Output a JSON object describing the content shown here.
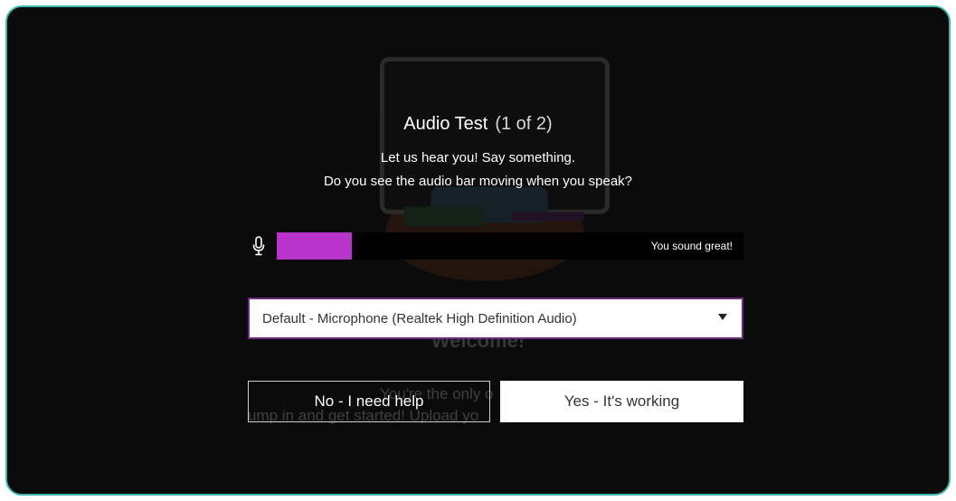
{
  "dialog": {
    "title": "Audio Test",
    "step": "(1 of 2)",
    "instruction_1": "Let us hear you! Say something.",
    "instruction_2": "Do you see the audio bar moving when you speak?"
  },
  "meter": {
    "level": 0.16,
    "status": "You sound great!",
    "fill_color": "#b833c9",
    "icon": "microphone-icon"
  },
  "device_select": {
    "selected": "Default - Microphone (Realtek High Definition Audio)"
  },
  "buttons": {
    "no_label": "No - I need help",
    "yes_label": "Yes - It's working"
  },
  "background": {
    "welcome": "Welcome!",
    "line_1": "You're the only o",
    "line_2": "ump in and get started! Upload yo"
  },
  "colors": {
    "frame_border": "#3fb8b0",
    "backdrop": "#0b0b0b",
    "select_border": "#6e2c7e"
  }
}
